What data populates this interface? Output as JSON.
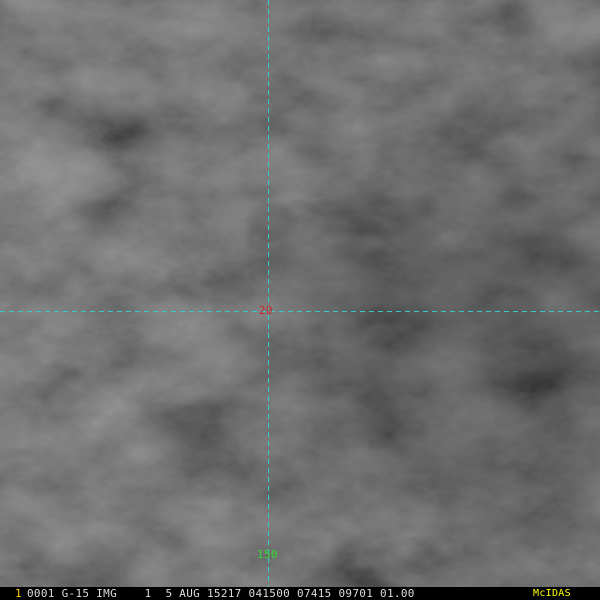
{
  "image": {
    "description_name": "satellite-visible-imagery"
  },
  "grid": {
    "line_color": "#33cccc",
    "latitude_label": "20",
    "latitude_label_color": "#cc2222",
    "longitude_label": "150",
    "longitude_label_color": "#33dd33"
  },
  "status_bar": {
    "frame_number": "1",
    "frame_number_color": "#ffcc00",
    "text": "0001 G-15 IMG    1  5 AUG 15217 041500 07415 09701 01.00",
    "text_color": "#dddddd",
    "logo": "McIDAS",
    "logo_color": "#ffff00"
  }
}
